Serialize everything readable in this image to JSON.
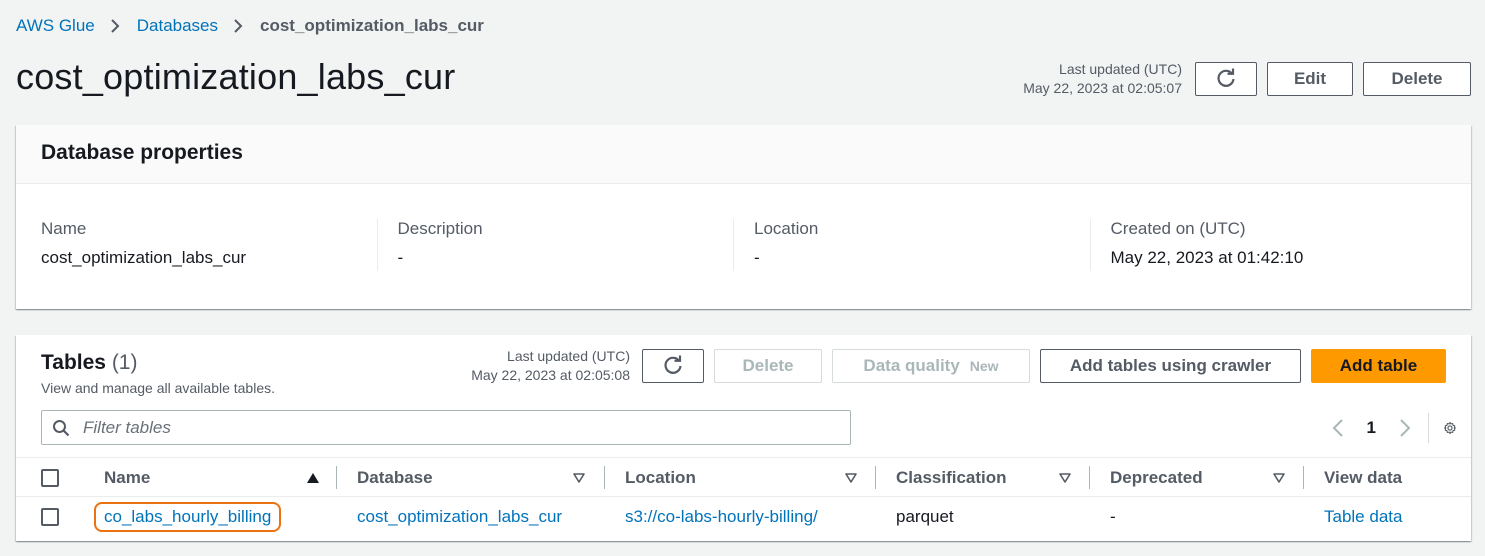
{
  "breadcrumb": {
    "items": [
      "AWS Glue",
      "Databases"
    ],
    "current": "cost_optimization_labs_cur"
  },
  "page": {
    "title": "cost_optimization_labs_cur",
    "last_updated_label": "Last updated (UTC)",
    "last_updated_value": "May 22, 2023 at 02:05:07",
    "edit_label": "Edit",
    "delete_label": "Delete"
  },
  "properties": {
    "title": "Database properties",
    "fields": [
      {
        "label": "Name",
        "value": "cost_optimization_labs_cur"
      },
      {
        "label": "Description",
        "value": "-"
      },
      {
        "label": "Location",
        "value": "-"
      },
      {
        "label": "Created on (UTC)",
        "value": "May 22, 2023 at 01:42:10"
      }
    ]
  },
  "tables": {
    "title": "Tables",
    "count": "(1)",
    "description": "View and manage all available tables.",
    "last_updated_label": "Last updated (UTC)",
    "last_updated_value": "May 22, 2023 at 02:05:08",
    "delete_label": "Delete",
    "data_quality_label": "Data quality",
    "new_badge": "New",
    "add_crawler_label": "Add tables using crawler",
    "add_table_label": "Add table",
    "filter_placeholder": "Filter tables",
    "current_page": "1",
    "columns": [
      "Name",
      "Database",
      "Location",
      "Classification",
      "Deprecated",
      "View data"
    ],
    "rows": [
      {
        "name": "co_labs_hourly_billing",
        "database": "cost_optimization_labs_cur",
        "location": "s3://co-labs-hourly-billing/",
        "classification": "parquet",
        "deprecated": "-",
        "view_data": "Table data"
      }
    ]
  },
  "icons": {
    "refresh": "refresh-icon",
    "search": "search-icon",
    "settings": "gear-icon",
    "chevron_left": "chevron-left-icon",
    "chevron_right": "chevron-right-icon",
    "sort_asc": "sort-ascending-icon",
    "sort_desc": "sort-descending-icon"
  },
  "colors": {
    "link": "#0073bb",
    "primary_button": "#ff9900",
    "highlight": "#ec7211",
    "background": "#f2f3f3"
  }
}
